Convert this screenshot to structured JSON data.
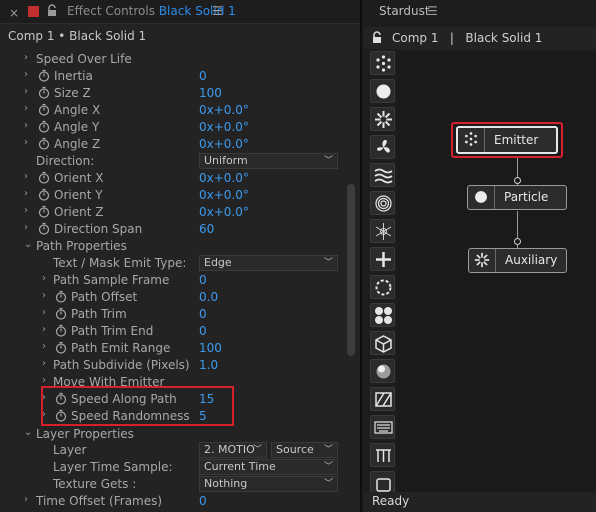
{
  "effect_controls": {
    "tab_title_prefix": "Effect Controls",
    "tab_layer_name": "Black Solid 1",
    "menu_icon": "hamburger-icon",
    "breadcrumb": "Comp 1 • Black Solid 1",
    "rows": {
      "speed_over_life": "Speed Over Life",
      "inertia": {
        "label": "Inertia",
        "value": "0"
      },
      "size_z": {
        "label": "Size Z",
        "value": "100"
      },
      "angle_x": {
        "label": "Angle X",
        "value": "0x+0.0°"
      },
      "angle_y": {
        "label": "Angle Y",
        "value": "0x+0.0°"
      },
      "angle_z": {
        "label": "Angle Z",
        "value": "0x+0.0°"
      },
      "direction": {
        "label": "Direction:",
        "value": "Uniform"
      },
      "orient_x": {
        "label": "Orient X",
        "value": "0x+0.0°"
      },
      "orient_y": {
        "label": "Orient Y",
        "value": "0x+0.0°"
      },
      "orient_z": {
        "label": "Orient Z",
        "value": "0x+0.0°"
      },
      "direction_span": {
        "label": "Direction Span",
        "value": "60"
      },
      "path_properties": "Path Properties",
      "text_mask_emit_type": {
        "label": "Text / Mask Emit Type:",
        "value": "Edge"
      },
      "path_sample_frame": {
        "label": "Path Sample Frame",
        "value": "0"
      },
      "path_offset": {
        "label": "Path Offset",
        "value": "0.0"
      },
      "path_trim": {
        "label": "Path Trim",
        "value": "0"
      },
      "path_trim_end": {
        "label": "Path Trim End",
        "value": "0"
      },
      "path_emit_range": {
        "label": "Path Emit Range",
        "value": "100"
      },
      "path_subdivide": {
        "label": "Path Subdivide (Pixels)",
        "value": "1.0"
      },
      "move_with_emitter": {
        "label": "Move With Emitter"
      },
      "speed_along_path": {
        "label": "Speed Along Path",
        "value": "15"
      },
      "speed_randomness": {
        "label": "Speed Randomness",
        "value": "5"
      },
      "layer_properties": "Layer Properties",
      "layer": {
        "label": "Layer",
        "value": "2. MOTIO",
        "source": "Source"
      },
      "layer_time_sample": {
        "label": "Layer Time Sample:",
        "value": "Current Time"
      },
      "texture_gets": {
        "label": "Texture Gets :",
        "value": "Nothing"
      },
      "time_offset": {
        "label": "Time Offset (Frames)",
        "value": "0"
      }
    }
  },
  "stardust": {
    "tab_title": "Stardust",
    "header": "Comp 1   |   Black Solid 1",
    "tools": [
      "emitter-dots-icon",
      "particle-circle-icon",
      "burst-icon",
      "fan-icon",
      "waves-icon",
      "rings-icon",
      "snowflake-icon",
      "plus-icon",
      "dashed-circle-icon",
      "four-dots-icon",
      "cube-icon",
      "sphere-icon",
      "slashed-square-icon",
      "keyboard-icon",
      "vertical-lines-icon",
      "square-icon"
    ],
    "nodes": {
      "emitter": "Emitter",
      "particle": "Particle",
      "auxiliary": "Auxiliary"
    },
    "status": "Ready"
  },
  "colors": {
    "accent_blue": "#3d9aef",
    "highlight_red": "#d8202a"
  }
}
